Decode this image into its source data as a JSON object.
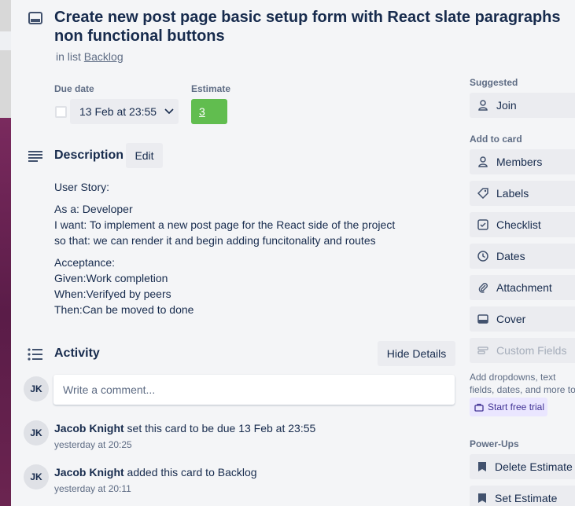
{
  "card": {
    "title": "Create new post page basic setup form with React slate paragraphs non functional buttons",
    "in_list_prefix": "in list",
    "list_name": "Backlog"
  },
  "dates": {
    "due_label": "Due date",
    "due_value": "13 Feb at 23:55",
    "estimate_label": "Estimate",
    "estimate_value": "3"
  },
  "description": {
    "title": "Description",
    "edit_label": "Edit",
    "story": "User Story:",
    "as_a": "As a: Developer",
    "i_want": "I want: To implement a new post page for the React side of the project",
    "so_that": "so that: we can render it and begin adding funcitonality and routes",
    "acceptance": "Acceptance:",
    "given": "Given:Work completion",
    "when": "When:Verifyed by peers",
    "then": "Then:Can be moved to done"
  },
  "activity": {
    "title": "Activity",
    "hide_details_label": "Hide Details",
    "comment_placeholder": "Write a comment...",
    "avatar_initials": "JK",
    "entries": [
      {
        "user": "Jacob Knight",
        "action": " set this card to be due 13 Feb at 23:55",
        "time": "yesterday at 20:25"
      },
      {
        "user": "Jacob Knight",
        "action": " added this card to Backlog",
        "time": "yesterday at 20:11"
      }
    ]
  },
  "sidebar": {
    "suggested_label": "Suggested",
    "join_label": "Join",
    "add_to_card_label": "Add to card",
    "members_label": "Members",
    "labels_label": "Labels",
    "checklist_label": "Checklist",
    "dates_label": "Dates",
    "attachment_label": "Attachment",
    "cover_label": "Cover",
    "custom_fields_label": "Custom Fields",
    "custom_fields_note": "Add dropdowns, text fields, dates, and more to your cards.",
    "trial_label": "Start free trial",
    "powerups_label": "Power-Ups",
    "delete_estimate_label": "Delete Estimate",
    "set_estimate_label": "Set Estimate"
  },
  "colors": {
    "estimate_green": "#61bd4f",
    "button_gray": "#ebecf0",
    "modal_bg": "#f4f5f7",
    "trial_purple": "#eae6ff"
  },
  "icons": {
    "header": "card-icon",
    "description": "description-icon",
    "activity": "activity-icon",
    "join": "person-icon",
    "members": "person-icon",
    "labels": "tag-icon",
    "checklist": "checklist-icon",
    "dates": "clock-icon",
    "attachment": "paperclip-icon",
    "cover": "cover-icon",
    "custom_fields": "custom-fields-icon",
    "trial": "briefcase-icon",
    "estimate": "estimate-icon"
  }
}
